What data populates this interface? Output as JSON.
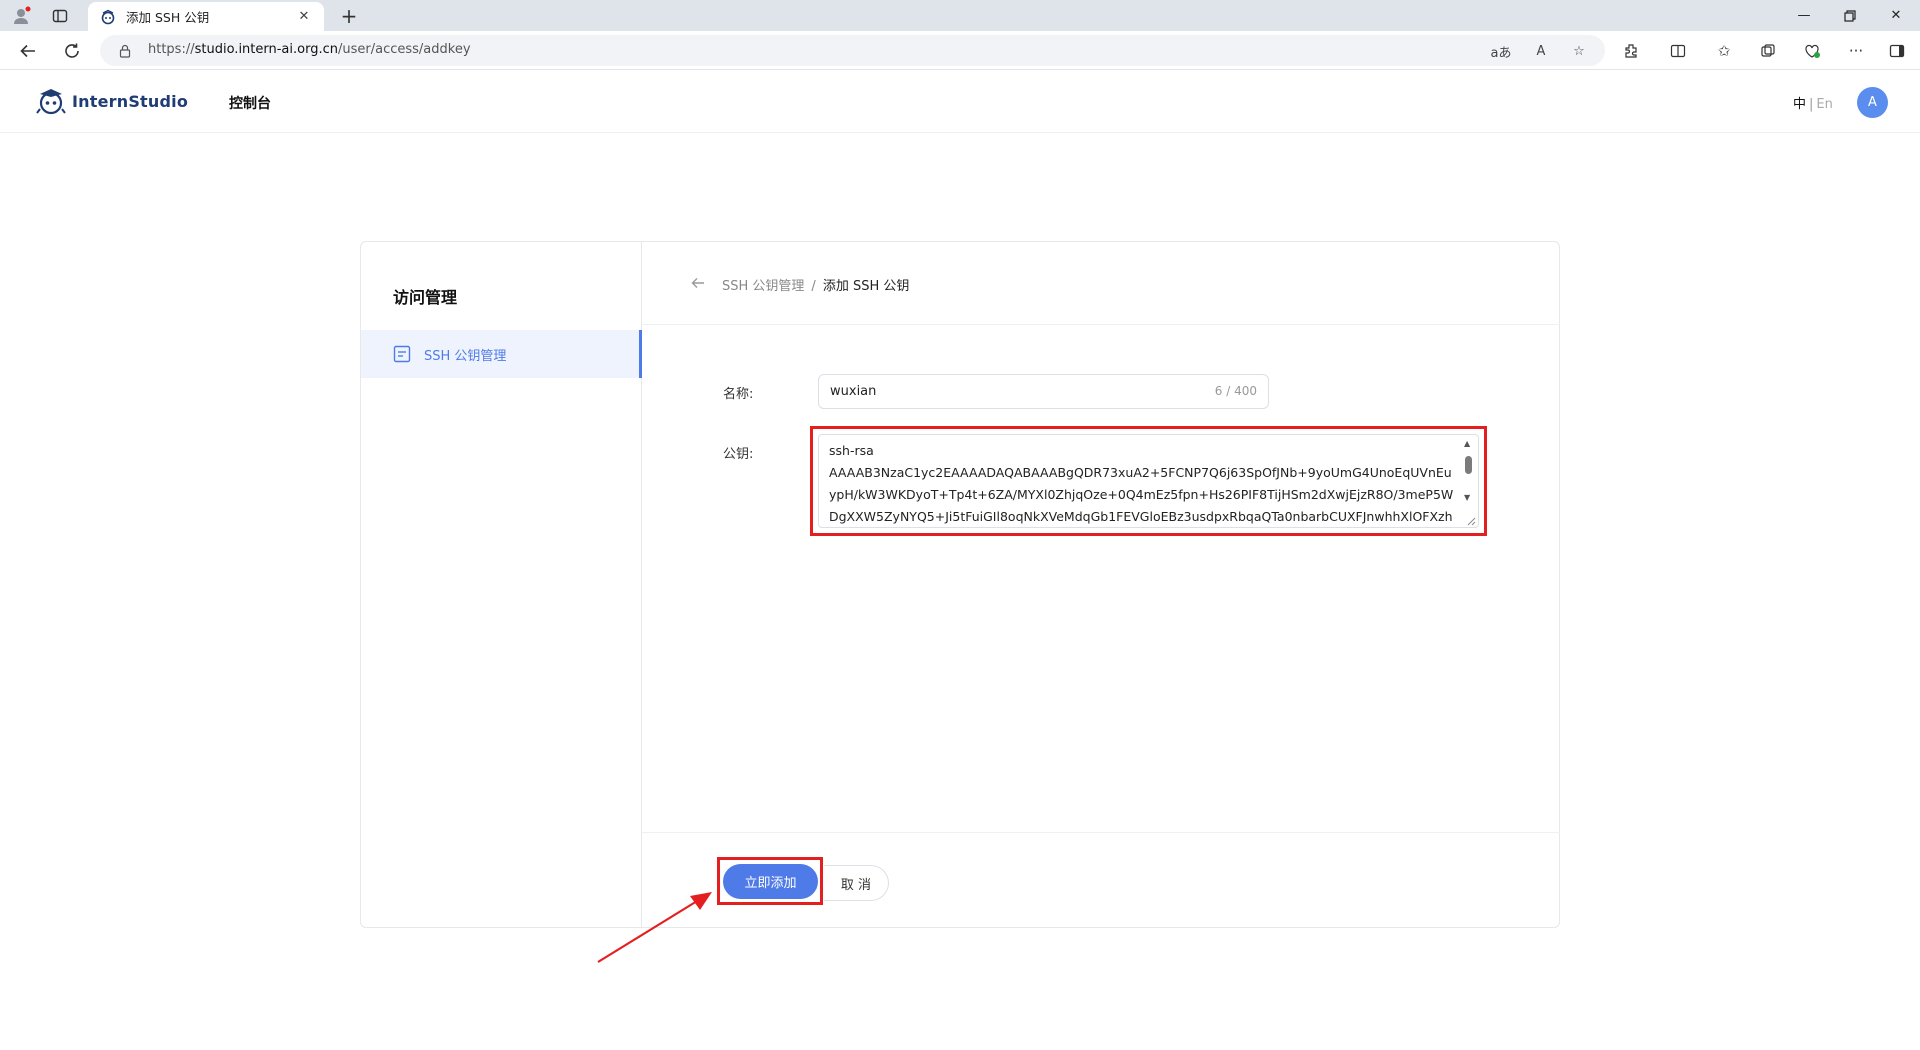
{
  "browser": {
    "tab_title": "添加 SSH 公钥",
    "url_prefix": "https://",
    "url_host": "studio.intern-ai.org.cn",
    "url_path": "/user/access/addkey"
  },
  "header": {
    "logo_text": "InternStudio",
    "console_label": "控制台",
    "lang_zh": "中",
    "lang_sep": "|",
    "lang_en": "En",
    "avatar_letter": "A"
  },
  "sidebar": {
    "title": "访问管理",
    "items": [
      {
        "label": "SSH 公钥管理",
        "active": true
      }
    ]
  },
  "breadcrumb": {
    "parent": "SSH 公钥管理",
    "separator": "/",
    "current": "添加 SSH 公钥"
  },
  "form": {
    "name_label": "名称:",
    "name_value": "wuxian",
    "name_count": "6 / 400",
    "key_label": "公钥:",
    "key_value": "ssh-rsa\nAAAAB3NzaC1yc2EAAAADAQABAAABgQDR73xuA2+5FCNP7Q6j63SpOfJNb+9yoUmG4UnoEqUVnEu\nypH/kW3WKDyoT+Tp4t+6ZA/MYXl0ZhjqOze+0Q4mEz5fpn+Hs26PIF8TijHSm2dXwjEjzR8O/3meP5W\nDgXXW5ZyNYQ5+Ji5tFuiGIl8oqNkXVeMdqGb1FEVGloEBz3usdpxRbqaQTa0nbarbCUXFJnwhhXlOFXzh"
  },
  "actions": {
    "submit_label": "立即添加",
    "cancel_label": "取 消"
  },
  "colors": {
    "primary": "#4f7be8",
    "highlight_box": "#e3201f",
    "active_bg": "#eef3fd"
  }
}
